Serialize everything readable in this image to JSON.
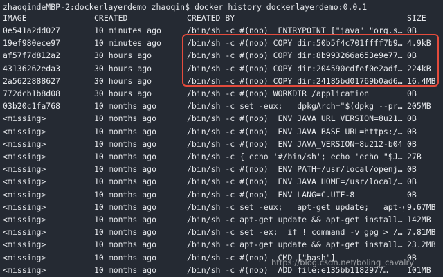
{
  "prompt": "zhaoqindeMBP-2:dockerlayerdemo zhaoqin$ docker history dockerlayerdemo:0.0.1",
  "headers": {
    "image": "IMAGE",
    "created": "CREATED",
    "created_by": "CREATED BY",
    "size": "SIZE"
  },
  "rows": [
    {
      "image": "0e541a2dd027",
      "created": "10 minutes ago",
      "created_by": "/bin/sh -c #(nop)  ENTRYPOINT [\"java\" \"org.s…",
      "size": "0B"
    },
    {
      "image": "19ef980ece97",
      "created": "10 minutes ago",
      "created_by": "/bin/sh -c #(nop) COPY dir:50b5f4c701ffff7b9…",
      "size": "4.9kB"
    },
    {
      "image": "af57f7d812a2",
      "created": "30 hours ago",
      "created_by": "/bin/sh -c #(nop) COPY dir:8b993266a653e9e77…",
      "size": "0B"
    },
    {
      "image": "43136262eda3",
      "created": "30 hours ago",
      "created_by": "/bin/sh -c #(nop) COPY dir:204590cdfef0e2adf…",
      "size": "224kB"
    },
    {
      "image": "2a5622888627",
      "created": "30 hours ago",
      "created_by": "/bin/sh -c #(nop) COPY dir:24185bd01769b0ad6…",
      "size": "16.4MB"
    },
    {
      "image": "772dcb1b8d08",
      "created": "30 hours ago",
      "created_by": "/bin/sh -c #(nop) WORKDIR /application",
      "size": "0B"
    },
    {
      "image": "03b20c1fa768",
      "created": "10 months ago",
      "created_by": "/bin/sh -c set -eux;   dpkgArch=\"$(dpkg --pr…",
      "size": "205MB"
    },
    {
      "image": "<missing>",
      "created": "10 months ago",
      "created_by": "/bin/sh -c #(nop)  ENV JAVA_URL_VERSION=8u21…",
      "size": "0B"
    },
    {
      "image": "<missing>",
      "created": "10 months ago",
      "created_by": "/bin/sh -c #(nop)  ENV JAVA_BASE_URL=https:/…",
      "size": "0B"
    },
    {
      "image": "<missing>",
      "created": "10 months ago",
      "created_by": "/bin/sh -c #(nop)  ENV JAVA_VERSION=8u212-b04",
      "size": "0B"
    },
    {
      "image": "<missing>",
      "created": "10 months ago",
      "created_by": "/bin/sh -c { echo '#/bin/sh'; echo 'echo \"$J…",
      "size": "27B"
    },
    {
      "image": "<missing>",
      "created": "10 months ago",
      "created_by": "/bin/sh -c #(nop)  ENV PATH=/usr/local/openj…",
      "size": "0B"
    },
    {
      "image": "<missing>",
      "created": "10 months ago",
      "created_by": "/bin/sh -c #(nop)  ENV JAVA_HOME=/usr/local/…",
      "size": "0B"
    },
    {
      "image": "<missing>",
      "created": "10 months ago",
      "created_by": "/bin/sh -c #(nop)  ENV LANG=C.UTF-8",
      "size": "0B"
    },
    {
      "image": "<missing>",
      "created": "10 months ago",
      "created_by": "/bin/sh -c set -eux;   apt-get update;   apt-g…",
      "size": "9.67MB"
    },
    {
      "image": "<missing>",
      "created": "10 months ago",
      "created_by": "/bin/sh -c apt-get update && apt-get install…",
      "size": "142MB"
    },
    {
      "image": "<missing>",
      "created": "10 months ago",
      "created_by": "/bin/sh -c set -ex;  if ! command -v gpg > /…",
      "size": "7.81MB"
    },
    {
      "image": "<missing>",
      "created": "10 months ago",
      "created_by": "/bin/sh -c apt-get update && apt-get install…",
      "size": "23.2MB"
    },
    {
      "image": "<missing>",
      "created": "10 months ago",
      "created_by": "/bin/sh -c #(nop)  CMD [\"bash\"]",
      "size": "0B"
    },
    {
      "image": "<missing>",
      "created": "10 months ago",
      "created_by": "/bin/sh -c #(nop)  ADD file:e135bb1182977…",
      "size": "101MB"
    }
  ],
  "watermark": "https://blog.csdn.net/boling_cavalry",
  "colors": {
    "background": "#252a33",
    "text": "#e6e8ec",
    "highlight_border": "#e34b3c"
  }
}
